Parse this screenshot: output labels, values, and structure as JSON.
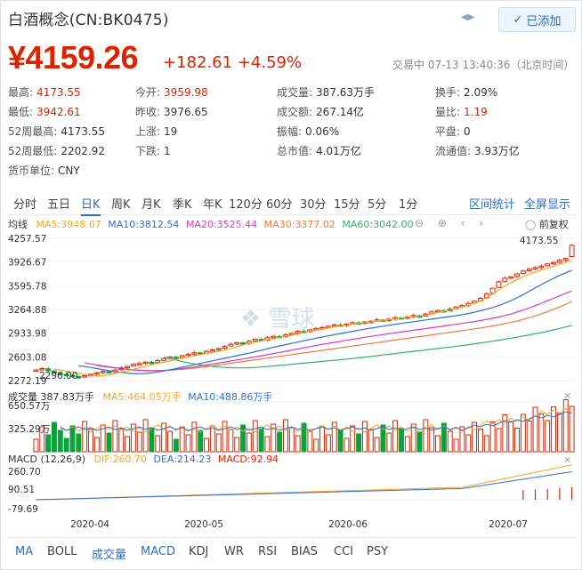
{
  "header": {
    "title": "白酒概念(CN:BK0475)",
    "follow_label": "已添加"
  },
  "quote": {
    "price": "¥4159.26",
    "change": "+182.61",
    "change_pct": "+4.59%",
    "status_text": "交易中 07-13 13:40:36（北京时间）"
  },
  "stats": [
    {
      "k": "最高:",
      "v": "4173.55",
      "c": "red"
    },
    {
      "k": "今开:",
      "v": "3959.98",
      "c": "red"
    },
    {
      "k": "成交量:",
      "v": "387.63万手",
      "c": ""
    },
    {
      "k": "换手:",
      "v": "2.09%",
      "c": ""
    },
    {
      "k": "最低:",
      "v": "3942.61",
      "c": "red"
    },
    {
      "k": "昨收:",
      "v": "3976.65",
      "c": ""
    },
    {
      "k": "成交额:",
      "v": "267.14亿",
      "c": ""
    },
    {
      "k": "量比:",
      "v": "1.19",
      "c": "red"
    },
    {
      "k": "52周最高:",
      "v": "4173.55",
      "c": ""
    },
    {
      "k": "上涨:",
      "v": "19",
      "c": ""
    },
    {
      "k": "振幅:",
      "v": "0.06%",
      "c": ""
    },
    {
      "k": "平盘:",
      "v": "0",
      "c": ""
    },
    {
      "k": "52周最低:",
      "v": "2202.92",
      "c": ""
    },
    {
      "k": "下跌:",
      "v": "1",
      "c": ""
    },
    {
      "k": "总市值:",
      "v": "4.01万亿",
      "c": ""
    },
    {
      "k": "流通值:",
      "v": "3.93万亿",
      "c": ""
    },
    {
      "k": "货币单位:",
      "v": "CNY",
      "c": ""
    }
  ],
  "period_tabs": [
    "分时",
    "五日",
    "日K",
    "周K",
    "月K",
    "季K",
    "年K",
    "120分",
    "60分",
    "30分",
    "15分",
    "5分",
    "1分"
  ],
  "period_active": "日K",
  "right_links": [
    "区间统计",
    "全屏显示"
  ],
  "ma_bar": {
    "label": "均线",
    "ma5": "MA5:3948.67",
    "ma10": "MA10:3812.54",
    "ma20": "MA20:3525.44",
    "ma30": "MA30:3377.02",
    "ma60": "MA60:3042.00",
    "adjust": "前复权"
  },
  "vol_bar": {
    "label": "成交量 387.83万手",
    "ma5": "MA5:464.05万手",
    "ma10": "MA10:488.86万手"
  },
  "macd_bar": {
    "label": "MACD (12,26,9)",
    "dif": "DIF:260.70",
    "dea": "DEA:214.23",
    "macd": "MACD:92.94"
  },
  "watermark": "雪球",
  "colors": {
    "up": "#dd2200",
    "down": "#09a33b",
    "ma5": "#f5a623",
    "ma10": "#2e6fcf",
    "ma20": "#d43cc0",
    "ma30": "#f07a3c",
    "ma60": "#2fb36b"
  },
  "bottom_tabs": [
    "MA",
    "BOLL",
    "成交量",
    "MACD",
    "KDJ",
    "WR",
    "RSI",
    "BIAS",
    "CCI",
    "PSY"
  ],
  "chart_data": {
    "type": "candlestick",
    "price_axis": [
      "4257.57",
      "3926.67",
      "3595.78",
      "3264.88",
      "2933.98",
      "2603.08",
      "2272.19"
    ],
    "price_axis_values": [
      4257.57,
      3926.67,
      3595.78,
      3264.88,
      2933.98,
      2603.08,
      2272.19
    ],
    "max_label": "4173.55",
    "min_label": "2296.00",
    "vol_axis": [
      "650.57万",
      "325.29万"
    ],
    "macd_axis": [
      "260.70",
      "90.51",
      "-79.69"
    ],
    "x_labels": [
      "2020-04",
      "2020-05",
      "2020-06",
      "2020-07"
    ],
    "closes": [
      2420,
      2440,
      2410,
      2380,
      2360,
      2350,
      2330,
      2320,
      2340,
      2360,
      2380,
      2400,
      2390,
      2420,
      2450,
      2470,
      2500,
      2510,
      2530,
      2520,
      2550,
      2580,
      2600,
      2590,
      2620,
      2640,
      2660,
      2650,
      2680,
      2700,
      2720,
      2750,
      2780,
      2800,
      2790,
      2820,
      2850,
      2830,
      2870,
      2890,
      2880,
      2910,
      2930,
      2960,
      2950,
      2980,
      3000,
      3010,
      3030,
      3050,
      3040,
      3060,
      3080,
      3070,
      3090,
      3100,
      3120,
      3110,
      3130,
      3150,
      3140,
      3160,
      3180,
      3170,
      3200,
      3230,
      3250,
      3240,
      3270,
      3300,
      3320,
      3350,
      3380,
      3420,
      3480,
      3560,
      3650,
      3700,
      3720,
      3760,
      3800,
      3830,
      3850,
      3870,
      3900,
      3920,
      3950,
      3976,
      4159
    ],
    "ma5": [
      2430,
      2420,
      2405,
      2390,
      2372,
      2356,
      2344,
      2336,
      2340,
      2352,
      2370,
      2390,
      2408,
      2428,
      2450,
      2470,
      2494,
      2514,
      2528,
      2546,
      2566,
      2584,
      2600,
      2618,
      2636,
      2650,
      2664,
      2680,
      2700,
      2720,
      2744,
      2770,
      2790,
      2808,
      2826,
      2840,
      2856,
      2874,
      2890,
      2906,
      2924,
      2944,
      2960,
      2974,
      2988,
      3006,
      3022,
      3036,
      3048,
      3060,
      3072,
      3080,
      3092,
      3102,
      3114,
      3124,
      3134,
      3144,
      3154,
      3166,
      3176,
      3188,
      3204,
      3222,
      3240,
      3258,
      3276,
      3298,
      3322,
      3352,
      3386,
      3430,
      3480,
      3540,
      3590,
      3640,
      3680,
      3720,
      3756,
      3786,
      3814,
      3840,
      3868,
      3896,
      3920,
      3948
    ],
    "ma10": [
      2480,
      2470,
      2455,
      2440,
      2425,
      2410,
      2398,
      2386,
      2376,
      2370,
      2368,
      2372,
      2380,
      2392,
      2406,
      2422,
      2440,
      2458,
      2476,
      2494,
      2512,
      2530,
      2548,
      2566,
      2584,
      2602,
      2620,
      2638,
      2656,
      2676,
      2696,
      2716,
      2736,
      2756,
      2774,
      2792,
      2810,
      2828,
      2846,
      2864,
      2880,
      2896,
      2912,
      2928,
      2944,
      2960,
      2976,
      2990,
      3004,
      3018,
      3032,
      3046,
      3058,
      3070,
      3082,
      3094,
      3106,
      3118,
      3130,
      3142,
      3154,
      3166,
      3178,
      3192,
      3208,
      3226,
      3246,
      3268,
      3292,
      3320,
      3352,
      3388,
      3428,
      3472,
      3518,
      3566,
      3612,
      3656,
      3700,
      3740,
      3776,
      3812
    ],
    "ma20": [
      2520,
      2505,
      2490,
      2476,
      2464,
      2452,
      2440,
      2430,
      2420,
      2414,
      2410,
      2408,
      2410,
      2414,
      2420,
      2428,
      2438,
      2450,
      2462,
      2476,
      2490,
      2504,
      2518,
      2532,
      2546,
      2560,
      2574,
      2588,
      2602,
      2618,
      2634,
      2650,
      2666,
      2682,
      2698,
      2714,
      2730,
      2746,
      2762,
      2778,
      2792,
      2806,
      2820,
      2834,
      2848,
      2862,
      2876,
      2890,
      2902,
      2914,
      2926,
      2938,
      2950,
      2962,
      2974,
      2986,
      2998,
      3010,
      3022,
      3034,
      3046,
      3058,
      3070,
      3082,
      3096,
      3110,
      3126,
      3142,
      3160,
      3180,
      3202,
      3228,
      3256,
      3286,
      3318,
      3352,
      3386,
      3420,
      3456,
      3490,
      3525
    ],
    "ma30": [
      2480,
      2470,
      2460,
      2450,
      2440,
      2432,
      2424,
      2418,
      2414,
      2412,
      2412,
      2414,
      2418,
      2424,
      2430,
      2438,
      2446,
      2456,
      2466,
      2478,
      2490,
      2502,
      2514,
      2526,
      2538,
      2550,
      2562,
      2574,
      2586,
      2598,
      2610,
      2622,
      2634,
      2646,
      2658,
      2670,
      2682,
      2694,
      2706,
      2718,
      2730,
      2742,
      2754,
      2766,
      2778,
      2790,
      2802,
      2814,
      2826,
      2838,
      2850,
      2862,
      2874,
      2886,
      2898,
      2910,
      2922,
      2934,
      2946,
      2958,
      2970,
      2982,
      2994,
      3006,
      3020,
      3034,
      3050,
      3066,
      3084,
      3104,
      3126,
      3150,
      3176,
      3204,
      3234,
      3266,
      3300,
      3336,
      3377
    ],
    "ma60": [
      2600,
      2580,
      2560,
      2540,
      2520,
      2505,
      2492,
      2480,
      2470,
      2462,
      2456,
      2452,
      2450,
      2450,
      2452,
      2456,
      2462,
      2468,
      2476,
      2484,
      2492,
      2500,
      2508,
      2516,
      2524,
      2532,
      2540,
      2548,
      2556,
      2564,
      2572,
      2580,
      2590,
      2600,
      2610,
      2620,
      2630,
      2640,
      2650,
      2660,
      2670,
      2680,
      2690,
      2700,
      2710,
      2720,
      2730,
      2740,
      2750,
      2762,
      2774,
      2786,
      2798,
      2810,
      2822,
      2836,
      2850,
      2864,
      2878,
      2894,
      2910,
      2926,
      2942,
      2960,
      2980,
      3000,
      3020,
      3042
    ]
  }
}
